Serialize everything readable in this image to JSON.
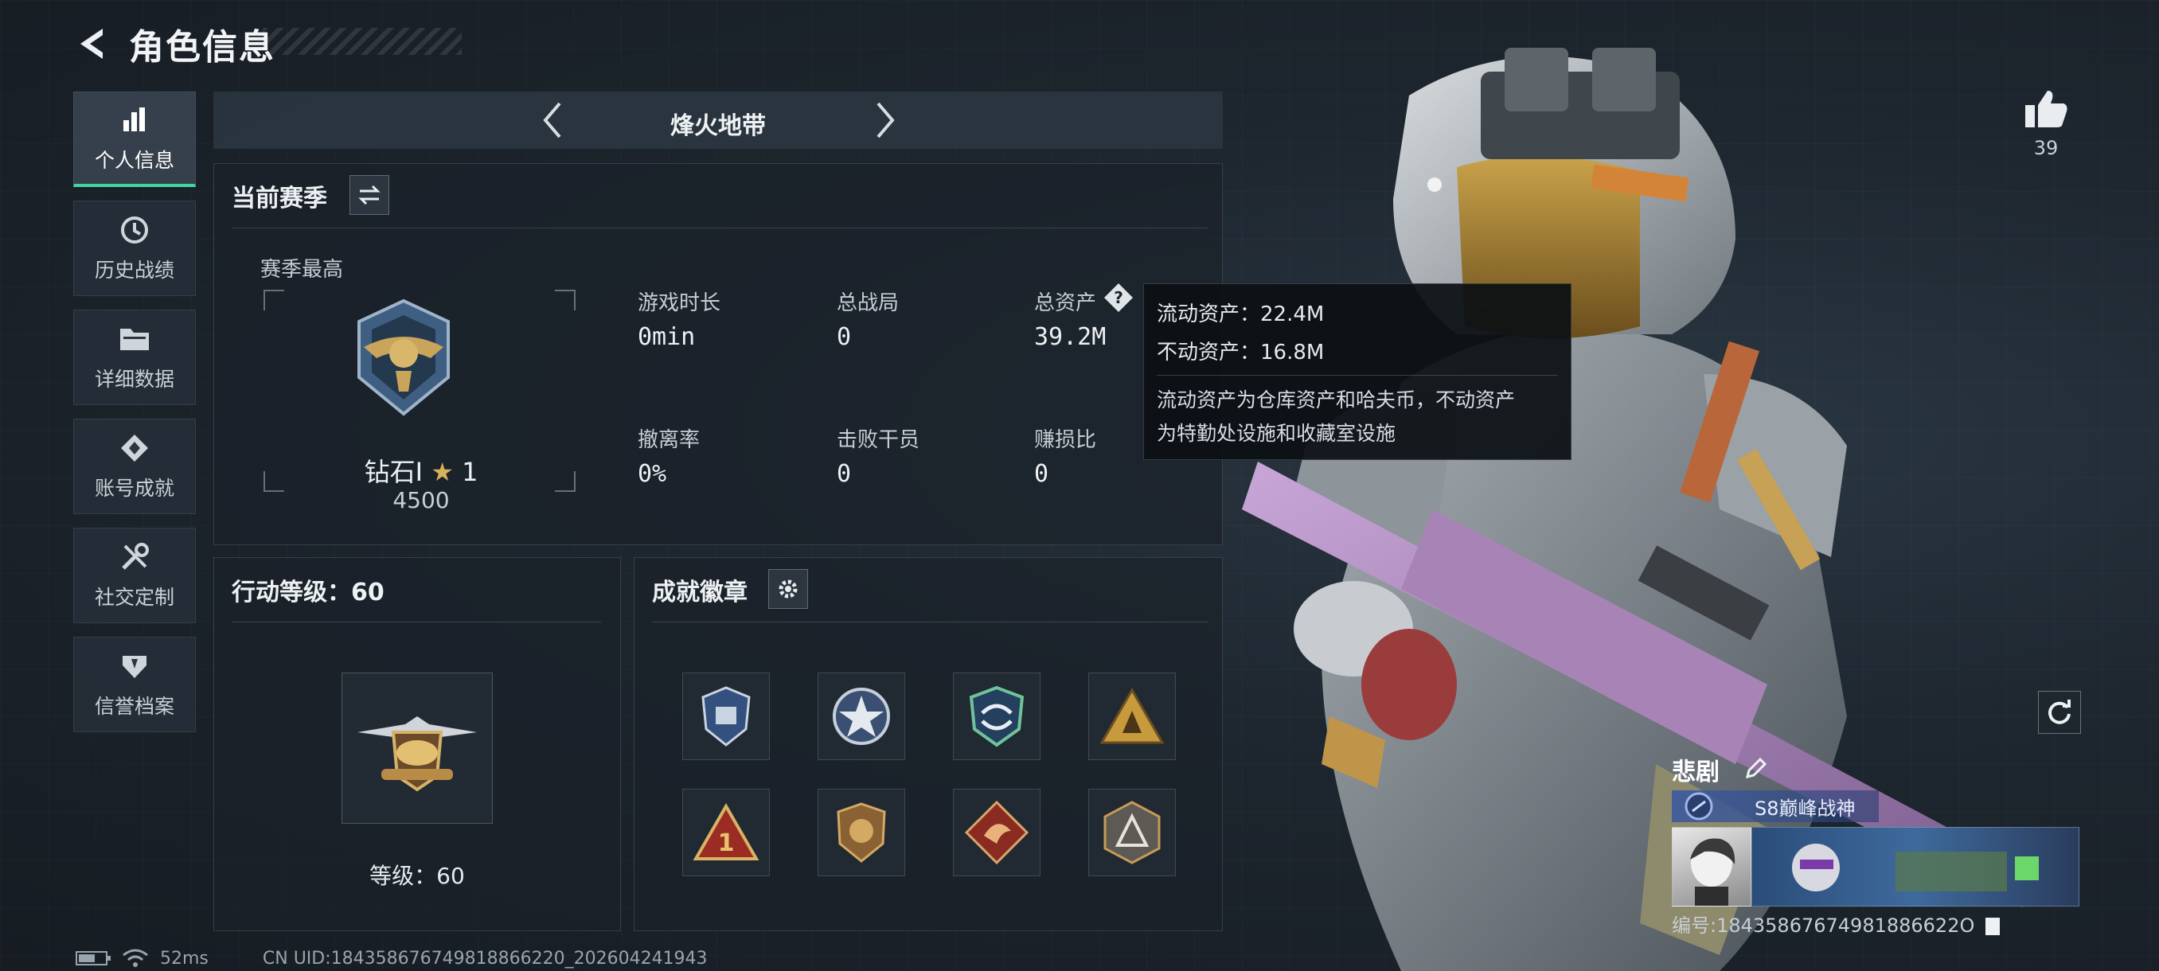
{
  "header": {
    "title": "角色信息"
  },
  "sidebar": {
    "items": [
      {
        "label": "个人信息",
        "icon": "bar-chart-icon",
        "active": true
      },
      {
        "label": "历史战绩",
        "icon": "history-icon",
        "active": false
      },
      {
        "label": "详细数据",
        "icon": "folder-icon",
        "active": false
      },
      {
        "label": "账号成就",
        "icon": "achievement-icon",
        "active": false
      },
      {
        "label": "社交定制",
        "icon": "tools-icon",
        "active": false
      },
      {
        "label": "信誉档案",
        "icon": "shield-icon",
        "active": false
      }
    ]
  },
  "mode": {
    "name": "烽火地带"
  },
  "season": {
    "title": "当前赛季",
    "best_label": "赛季最高",
    "rank_name": "钻石I",
    "rank_stars": "1",
    "rank_score": "4500",
    "stats": [
      {
        "label": "游戏时长",
        "value": "0min"
      },
      {
        "label": "总战局",
        "value": "0"
      },
      {
        "label": "总资产",
        "value": "39.2M"
      },
      {
        "label": "撤离率",
        "value": "0%"
      },
      {
        "label": "击败干员",
        "value": "0"
      },
      {
        "label": "赚损比",
        "value": "0"
      }
    ]
  },
  "tooltip": {
    "liquid": "流动资产：22.4M",
    "fixed": "不动资产：16.8M",
    "desc_line1": "流动资产为仓库资产和哈夫币，不动资产",
    "desc_line2": "为特勤处设施和收藏室设施"
  },
  "action_level": {
    "title": "行动等级：60",
    "level_text": "等级：60"
  },
  "badges": {
    "title": "成就徽章",
    "items": [
      "badge-blue-shield",
      "badge-star-circle",
      "badge-green-arrows",
      "badge-gold-triangle",
      "badge-red-triangle",
      "badge-bronze-lion",
      "badge-dragon-diamond",
      "badge-grey-hex"
    ]
  },
  "likes": {
    "count": "39"
  },
  "player": {
    "name": "悲剧",
    "title_tag": "S8巅峰战神",
    "id_text": "编号:18435867674981886622O"
  },
  "status": {
    "ping": "52ms",
    "uid": "CN UID:184358676749818866220_202604241943"
  },
  "colors": {
    "accent": "#3fd6a3",
    "panel_bg": "#1a2129",
    "tag_blue": "#3c5aa0"
  }
}
